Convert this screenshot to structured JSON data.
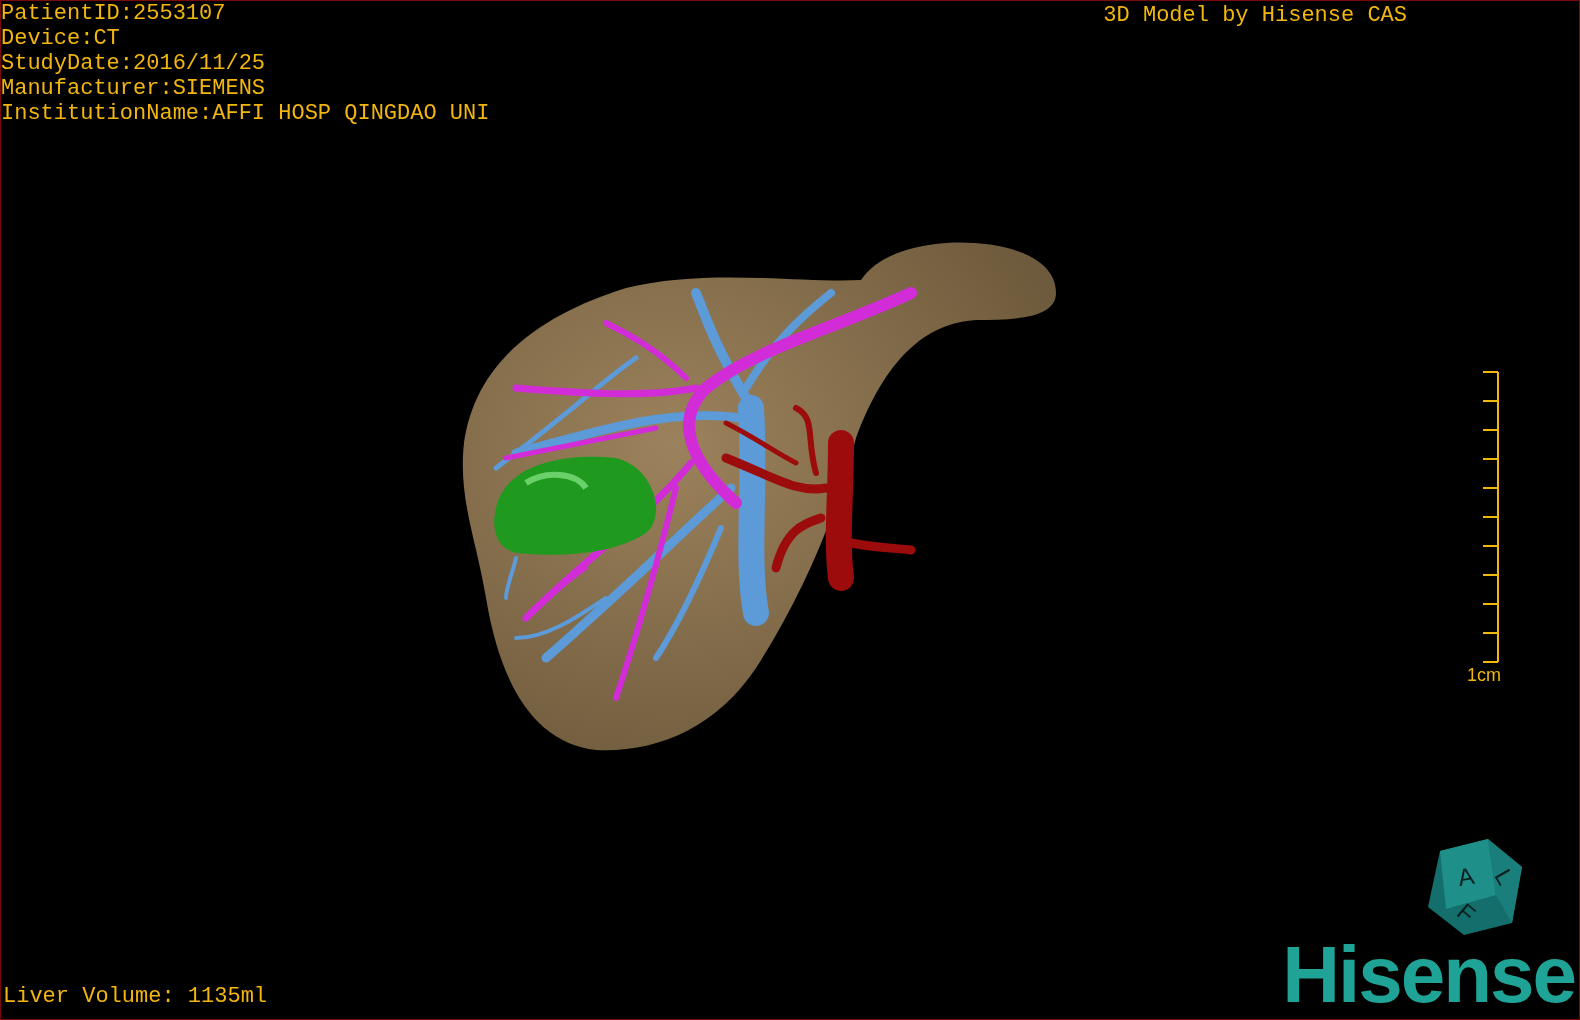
{
  "overlay": {
    "patient_info": [
      "PatientID:2553107",
      "Device:CT",
      "StudyDate:2016/11/25",
      "Manufacturer:SIEMENS",
      "InstitutionName:AFFI HOSP QINGDAO UNI"
    ],
    "title": "3D Model by Hisense CAS",
    "liver_volume": "Liver Volume: 1135ml"
  },
  "scale_bar": {
    "label": "1cm"
  },
  "orientation_cube": {
    "faces": [
      "A",
      "L",
      "F"
    ]
  },
  "logo": {
    "text": "Hisense"
  }
}
